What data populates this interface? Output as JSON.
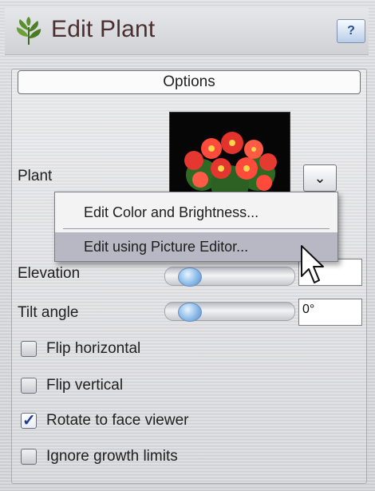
{
  "window": {
    "title": "Edit Plant",
    "help_label": "?"
  },
  "group": {
    "tab_label": "Options"
  },
  "plant": {
    "label": "Plant",
    "dropdown_icon": "chevron-down-icon"
  },
  "menu": {
    "items": [
      {
        "label": "Edit Color and Brightness..."
      },
      {
        "label": "Edit using Picture Editor..."
      }
    ]
  },
  "elevation": {
    "label": "Elevation",
    "value": ""
  },
  "tilt": {
    "label": "Tilt angle",
    "value": "0°"
  },
  "checkboxes": [
    {
      "label": "Flip horizontal",
      "checked": false
    },
    {
      "label": "Flip vertical",
      "checked": false
    },
    {
      "label": "Rotate to face viewer",
      "checked": true
    },
    {
      "label": "Ignore growth limits",
      "checked": false
    }
  ],
  "colors": {
    "accent": "#1e3d8f",
    "title_text": "#4a2f2f"
  }
}
